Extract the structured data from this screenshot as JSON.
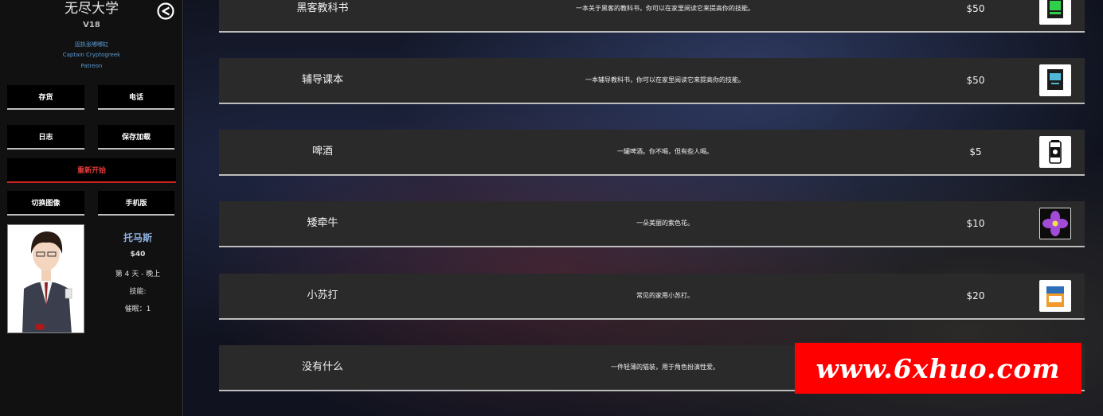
{
  "sidebar": {
    "title": "无尽大学",
    "version": "V18",
    "credits": [
      "固执张嘟嘟缸",
      "Captain Cryptogreek",
      "Patreon"
    ],
    "buttons": {
      "inventory": "存货",
      "phone": "电话",
      "journal": "日志",
      "save_load": "保存加载",
      "restart": "重新开始",
      "switch_image": "切换图像",
      "mobile": "手机版"
    },
    "character": {
      "name": "托马斯",
      "money": "$40",
      "day_time": "第 4 天 - 晚上",
      "skills": "技能:",
      "hypnosis": "催眠：1"
    }
  },
  "shop": {
    "items": [
      {
        "name": "黑客教科书",
        "desc": "一本关于黑客的教科书，你可以在家里阅读它来提高你的技能。",
        "price": "$50",
        "icon": "hacking-book-icon"
      },
      {
        "name": "辅导课本",
        "desc": "一本辅导教科书，你可以在家里阅读它来提高你的技能。",
        "price": "$50",
        "icon": "tutoring-book-icon"
      },
      {
        "name": "啤酒",
        "desc": "一罐啤酒。你不喝，但有些人喝。",
        "price": "$5",
        "icon": "beer-can-icon"
      },
      {
        "name": "矮牵牛",
        "desc": "一朵美丽的紫色花。",
        "price": "$10",
        "icon": "purple-flower-icon"
      },
      {
        "name": "小苏打",
        "desc": "常见的家用小苏打。",
        "price": "$20",
        "icon": "baking-soda-icon"
      },
      {
        "name": "没有什么",
        "desc": "一件轻薄的猫装，用于角色扮演性爱。",
        "price": "",
        "icon": ""
      }
    ]
  },
  "watermark": "www.6xhuo.com",
  "colors": {
    "sidebar_bg": "#111111",
    "row_bg": "#2a2a2a",
    "accent_red": "#cc2222",
    "link_blue": "#5b9bd5"
  }
}
